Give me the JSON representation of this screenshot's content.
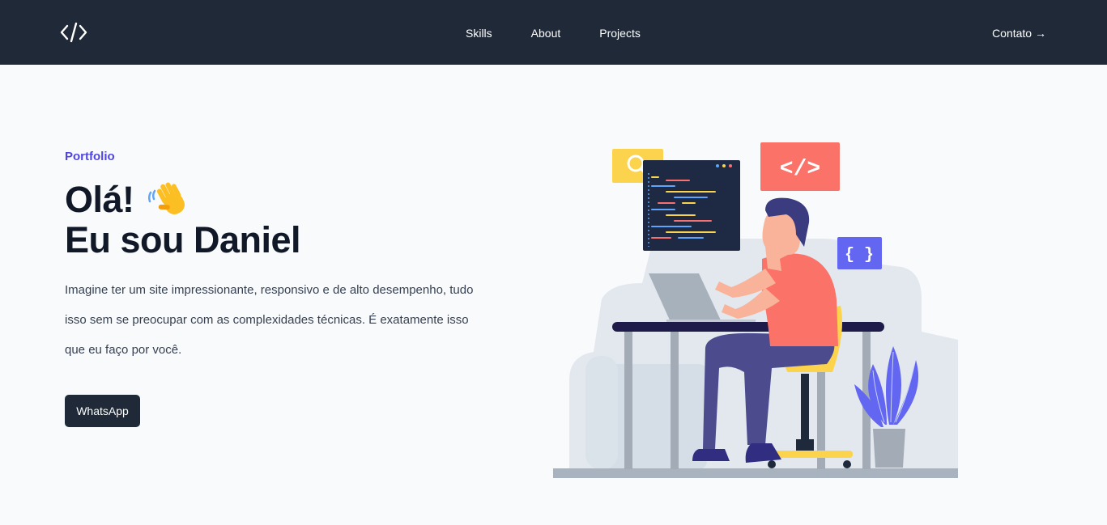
{
  "nav": {
    "logo_icon": "code-brackets-icon",
    "links": [
      {
        "label": "Skills"
      },
      {
        "label": "About"
      },
      {
        "label": "Projects"
      }
    ],
    "contact_label": "Contato →"
  },
  "hero": {
    "eyebrow": "Portfolio",
    "title_line1": "Olá!",
    "title_line2": "Eu sou Daniel",
    "wave_icon": "waving-hand-icon",
    "description": "Imagine ter um site impressionante, responsivo e de alto desempenho, tudo isso sem se preocupar com as complexidades técnicas. É exatamente isso que eu faço por você.",
    "cta_label": "WhatsApp"
  },
  "illustration": {
    "code_tag_text": "</>",
    "braces_text": "{ }"
  },
  "colors": {
    "nav_bg": "#1f2937",
    "accent": "#4f46e5",
    "page_bg": "#f8fafc",
    "coral": "#fa7268",
    "yellow": "#fcd34d",
    "purple": "#6366f1"
  }
}
